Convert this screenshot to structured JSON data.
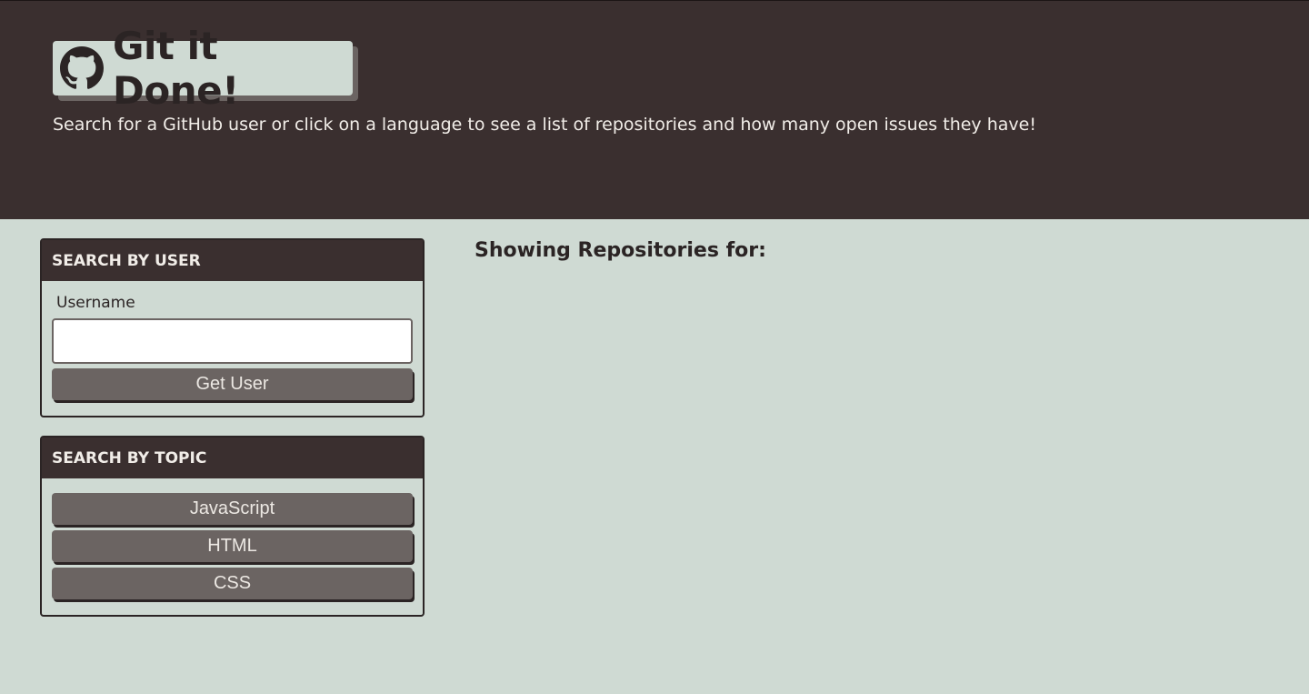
{
  "header": {
    "logo_text": "Git it Done!",
    "logo_icon": "github-octocat-icon",
    "subtitle": "Search for a GitHub user or click on a language to see a list of repositories and how many open issues they have!"
  },
  "user_search": {
    "title": "SEARCH BY USER",
    "field_label": "Username",
    "input_value": "",
    "input_placeholder": "",
    "button_label": "Get User"
  },
  "topic_search": {
    "title": "SEARCH BY TOPIC",
    "buttons": [
      "JavaScript",
      "HTML",
      "CSS"
    ]
  },
  "results": {
    "title": "Showing Repositories for:"
  },
  "colors": {
    "background": "#cfdad3",
    "header": "#3a2f2f",
    "button": "#6b6462",
    "text_dark": "#2b2424",
    "text_light": "#f1ede8"
  }
}
